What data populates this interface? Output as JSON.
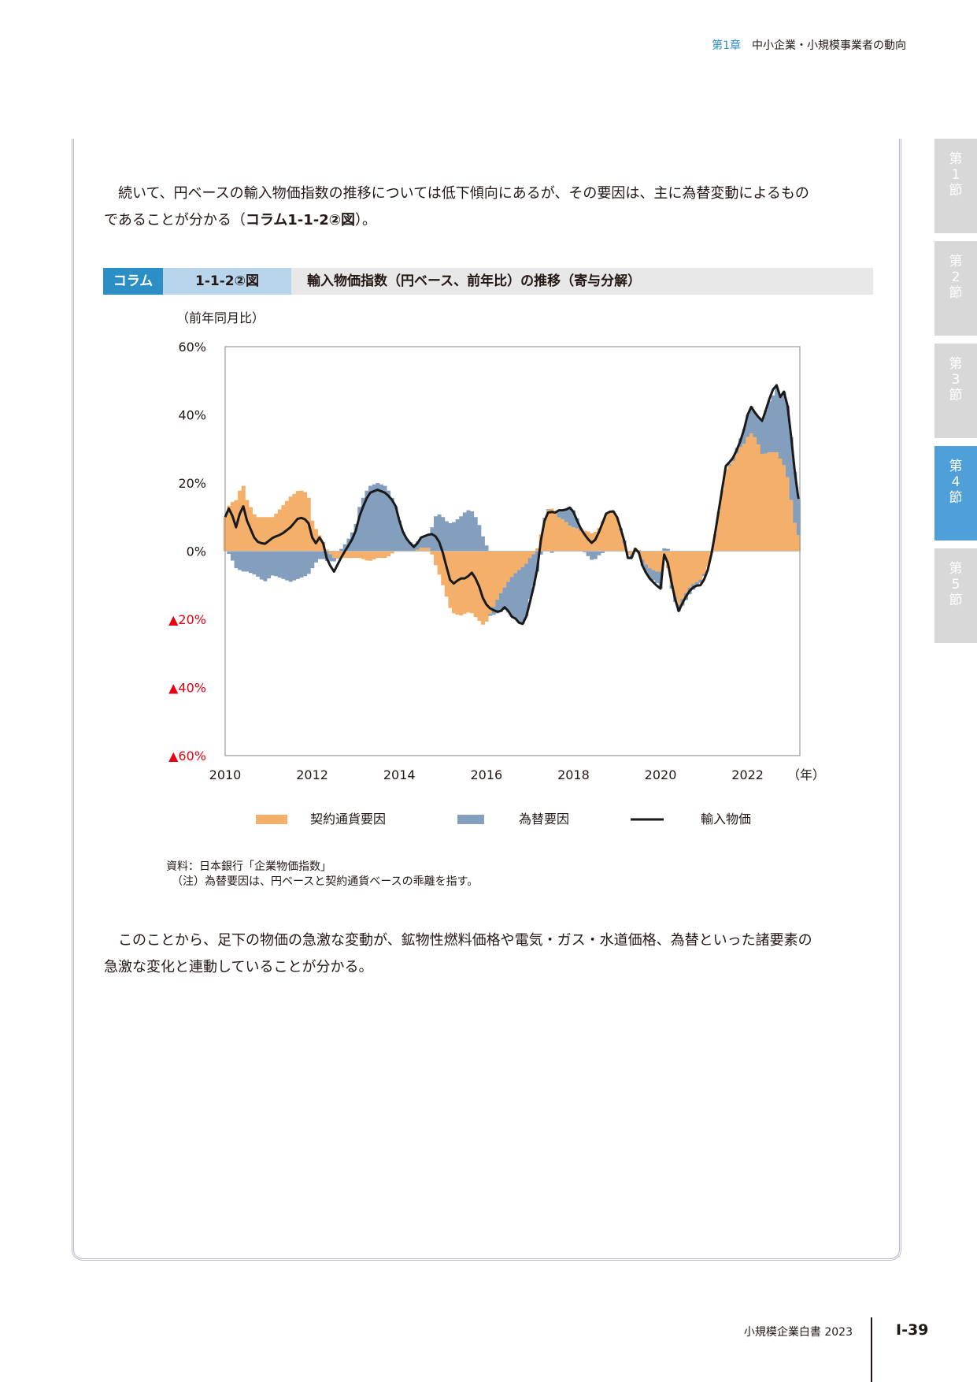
{
  "header": {
    "chapter": "第1章",
    "title": "中小企業・小規模事業者の動向"
  },
  "paragraphs": {
    "intro_1": "続いて、円ベースの輸入物価指数の推移については低下傾向にあるが、その要因は、主に為替変動によるもの",
    "intro_2a": "であることが分かる（",
    "intro_2b": "コラム1-1-2②図",
    "intro_2c": "）。",
    "outro_1": "このことから、足下の物価の急激な変動が、鉱物性燃料価格や電気・ガス・水道価格、為替といった諸要素の",
    "outro_2": "急激な変化と連動していることが分かる。"
  },
  "figure": {
    "tag": "コラム",
    "number": "1-1-2②図",
    "title": "輸入物価指数（円ベース、前年比）の推移（寄与分解）",
    "source": "資料：日本銀行「企業物価指数」",
    "note": "（注）為替要因は、円ベースと契約通貨ベースの乖離を指す。"
  },
  "side_tabs": [
    {
      "label": "第1節",
      "active": false
    },
    {
      "label": "第2節",
      "active": false
    },
    {
      "label": "第3節",
      "active": false
    },
    {
      "label": "第4節",
      "active": true
    },
    {
      "label": "第5節",
      "active": false
    }
  ],
  "footer": {
    "book_title": "小規模企業白書 2023",
    "page": "Ⅰ-39"
  },
  "chart_data": {
    "type": "bar",
    "ylabel": "（前年同月比）",
    "xlabel": "（年）",
    "ylim": [
      -60,
      60
    ],
    "xlim": [
      2010,
      2023.2
    ],
    "x_ticks": [
      "2010",
      "2012",
      "2014",
      "2016",
      "2018",
      "2020",
      "2022"
    ],
    "y_ticks": [
      {
        "value": 60,
        "label": "60%"
      },
      {
        "value": 40,
        "label": "40%"
      },
      {
        "value": 20,
        "label": "20%"
      },
      {
        "value": 0,
        "label": "0%"
      },
      {
        "value": -20,
        "label": "▲20%"
      },
      {
        "value": -40,
        "label": "▲40%"
      },
      {
        "value": -60,
        "label": "▲60%"
      }
    ],
    "negative_label_color": "#e60012",
    "grid": false,
    "legend_position": "bottom",
    "series": [
      {
        "name": "契約通貨要因",
        "kind": "stacked-bar",
        "color": "#f4b06b"
      },
      {
        "name": "為替要因",
        "kind": "stacked-bar",
        "color": "#849fbe"
      },
      {
        "name": "輸入物価",
        "kind": "line",
        "color": "#1a1a1a"
      }
    ],
    "keypoints": [
      {
        "x": 2010.0,
        "c": 10,
        "f": 0,
        "t": 10
      },
      {
        "x": 2010.1,
        "c": 14,
        "f": -1,
        "t": 13
      },
      {
        "x": 2010.25,
        "c": 15,
        "f": -5,
        "t": 7
      },
      {
        "x": 2010.4,
        "c": 20,
        "f": -6,
        "t": 14
      },
      {
        "x": 2010.5,
        "c": 15,
        "f": -6,
        "t": 9
      },
      {
        "x": 2010.7,
        "c": 10,
        "f": -7,
        "t": 3
      },
      {
        "x": 2010.9,
        "c": 10,
        "f": -9,
        "t": 2
      },
      {
        "x": 2011.1,
        "c": 10,
        "f": -7,
        "t": 4
      },
      {
        "x": 2011.3,
        "c": 13,
        "f": -8,
        "t": 5
      },
      {
        "x": 2011.5,
        "c": 16,
        "f": -9,
        "t": 7
      },
      {
        "x": 2011.7,
        "c": 18,
        "f": -8,
        "t": 10
      },
      {
        "x": 2011.9,
        "c": 17,
        "f": -7,
        "t": 9
      },
      {
        "x": 2012.0,
        "c": 9,
        "f": -5,
        "t": 4
      },
      {
        "x": 2012.1,
        "c": 6,
        "f": -3,
        "t": 2
      },
      {
        "x": 2012.2,
        "c": 4,
        "f": -2,
        "t": 5
      },
      {
        "x": 2012.35,
        "c": 0,
        "f": -3,
        "t": -3
      },
      {
        "x": 2012.5,
        "c": -2,
        "f": -1,
        "t": -6
      },
      {
        "x": 2012.7,
        "c": -2,
        "f": 1,
        "t": -1
      },
      {
        "x": 2012.9,
        "c": -2,
        "f": 5,
        "t": 3
      },
      {
        "x": 2013.0,
        "c": -2,
        "f": 8,
        "t": 6
      },
      {
        "x": 2013.1,
        "c": -2,
        "f": 14,
        "t": 11
      },
      {
        "x": 2013.3,
        "c": -3,
        "f": 19,
        "t": 17
      },
      {
        "x": 2013.5,
        "c": -2,
        "f": 20,
        "t": 18
      },
      {
        "x": 2013.7,
        "c": -2,
        "f": 19,
        "t": 17
      },
      {
        "x": 2013.9,
        "c": 0,
        "f": 14,
        "t": 14
      },
      {
        "x": 2014.0,
        "c": 0,
        "f": 9,
        "t": 9
      },
      {
        "x": 2014.1,
        "c": 0,
        "f": 5,
        "t": 5
      },
      {
        "x": 2014.2,
        "c": 0,
        "f": 3,
        "t": 3
      },
      {
        "x": 2014.35,
        "c": 0,
        "f": 2,
        "t": 1
      },
      {
        "x": 2014.5,
        "c": 1,
        "f": 3,
        "t": 4
      },
      {
        "x": 2014.7,
        "c": 1,
        "f": 4,
        "t": 5
      },
      {
        "x": 2014.8,
        "c": -3,
        "f": 10,
        "t": 5
      },
      {
        "x": 2014.95,
        "c": -8,
        "f": 11,
        "t": 2
      },
      {
        "x": 2015.05,
        "c": -12,
        "f": 9,
        "t": -3
      },
      {
        "x": 2015.2,
        "c": -18,
        "f": 8,
        "t": -10
      },
      {
        "x": 2015.4,
        "c": -19,
        "f": 10,
        "t": -8
      },
      {
        "x": 2015.55,
        "c": -18,
        "f": 12,
        "t": -8
      },
      {
        "x": 2015.65,
        "c": -18,
        "f": 12,
        "t": -6
      },
      {
        "x": 2015.8,
        "c": -20,
        "f": 9,
        "t": -9
      },
      {
        "x": 2015.95,
        "c": -22,
        "f": 3,
        "t": -15
      },
      {
        "x": 2016.1,
        "c": -18,
        "f": -1,
        "t": -17
      },
      {
        "x": 2016.3,
        "c": -13,
        "f": -5,
        "t": -18
      },
      {
        "x": 2016.45,
        "c": -10,
        "f": -7,
        "t": -16
      },
      {
        "x": 2016.55,
        "c": -8,
        "f": -11,
        "t": -19
      },
      {
        "x": 2016.7,
        "c": -6,
        "f": -14,
        "t": -20
      },
      {
        "x": 2016.8,
        "c": -5,
        "f": -17,
        "t": -22
      },
      {
        "x": 2016.9,
        "c": -4,
        "f": -16,
        "t": -20
      },
      {
        "x": 2017.0,
        "c": -2,
        "f": -12,
        "t": -15
      },
      {
        "x": 2017.15,
        "c": 0,
        "f": -7,
        "t": -7
      },
      {
        "x": 2017.25,
        "c": 5,
        "f": -1,
        "t": 3
      },
      {
        "x": 2017.35,
        "c": 10,
        "f": 1,
        "t": 10
      },
      {
        "x": 2017.45,
        "c": 13,
        "f": 0,
        "t": 12
      },
      {
        "x": 2017.55,
        "c": 12,
        "f": -1,
        "t": 11
      },
      {
        "x": 2017.65,
        "c": 10,
        "f": 2,
        "t": 12
      },
      {
        "x": 2017.8,
        "c": 9,
        "f": 3,
        "t": 12
      },
      {
        "x": 2017.95,
        "c": 7,
        "f": 6,
        "t": 13
      },
      {
        "x": 2018.05,
        "c": 7,
        "f": 4,
        "t": 10
      },
      {
        "x": 2018.15,
        "c": 6,
        "f": 1,
        "t": 7
      },
      {
        "x": 2018.3,
        "c": 6,
        "f": -1,
        "t": 4
      },
      {
        "x": 2018.45,
        "c": 5,
        "f": -3,
        "t": 2
      },
      {
        "x": 2018.6,
        "c": 7,
        "f": -1,
        "t": 6
      },
      {
        "x": 2018.75,
        "c": 11,
        "f": 0,
        "t": 11
      },
      {
        "x": 2018.9,
        "c": 12,
        "f": 0,
        "t": 12
      },
      {
        "x": 2019.0,
        "c": 10,
        "f": 0,
        "t": 10
      },
      {
        "x": 2019.15,
        "c": 3,
        "f": 1,
        "t": 4
      },
      {
        "x": 2019.25,
        "c": -1,
        "f": 0,
        "t": -2
      },
      {
        "x": 2019.35,
        "c": -1,
        "f": -1,
        "t": -2
      },
      {
        "x": 2019.45,
        "c": 2,
        "f": 0,
        "t": 2
      },
      {
        "x": 2019.6,
        "c": -3,
        "f": -2,
        "t": -5
      },
      {
        "x": 2019.75,
        "c": -5,
        "f": -3,
        "t": -8
      },
      {
        "x": 2019.9,
        "c": -6,
        "f": -3,
        "t": -10
      },
      {
        "x": 2020.0,
        "c": -6,
        "f": -5,
        "t": -11
      },
      {
        "x": 2020.1,
        "c": -1,
        "f": 2,
        "t": 1
      },
      {
        "x": 2020.25,
        "c": -10,
        "f": -1,
        "t": -9
      },
      {
        "x": 2020.4,
        "c": -16,
        "f": -2,
        "t": -18
      },
      {
        "x": 2020.55,
        "c": -13,
        "f": -2,
        "t": -14
      },
      {
        "x": 2020.7,
        "c": -10,
        "f": -2,
        "t": -11
      },
      {
        "x": 2020.85,
        "c": -9,
        "f": -1,
        "t": -10
      },
      {
        "x": 2020.95,
        "c": -8,
        "f": -1,
        "t": -10
      },
      {
        "x": 2021.1,
        "c": -4,
        "f": 0,
        "t": -5
      },
      {
        "x": 2021.2,
        "c": 1,
        "f": 0,
        "t": 1
      },
      {
        "x": 2021.35,
        "c": 13,
        "f": 0,
        "t": 13
      },
      {
        "x": 2021.5,
        "c": 24,
        "f": 0,
        "t": 25
      },
      {
        "x": 2021.65,
        "c": 26,
        "f": 1,
        "t": 27
      },
      {
        "x": 2021.8,
        "c": 30,
        "f": 2,
        "t": 31
      },
      {
        "x": 2021.95,
        "c": 32,
        "f": 5,
        "t": 37
      },
      {
        "x": 2022.05,
        "c": 35,
        "f": 8,
        "t": 43
      },
      {
        "x": 2022.2,
        "c": 33,
        "f": 7,
        "t": 40
      },
      {
        "x": 2022.35,
        "c": 28,
        "f": 10,
        "t": 38
      },
      {
        "x": 2022.45,
        "c": 29,
        "f": 14,
        "t": 43
      },
      {
        "x": 2022.6,
        "c": 29,
        "f": 17,
        "t": 48
      },
      {
        "x": 2022.7,
        "c": 29,
        "f": 20,
        "t": 49
      },
      {
        "x": 2022.78,
        "c": 26,
        "f": 17,
        "t": 43
      },
      {
        "x": 2022.85,
        "c": 25,
        "f": 23,
        "t": 48
      },
      {
        "x": 2022.95,
        "c": 20,
        "f": 20,
        "t": 40
      },
      {
        "x": 2023.05,
        "c": 10,
        "f": 17,
        "t": 27
      },
      {
        "x": 2023.15,
        "c": 5,
        "f": 11,
        "t": 16
      },
      {
        "x": 2023.2,
        "c": 4,
        "f": 10,
        "t": 14
      }
    ]
  }
}
